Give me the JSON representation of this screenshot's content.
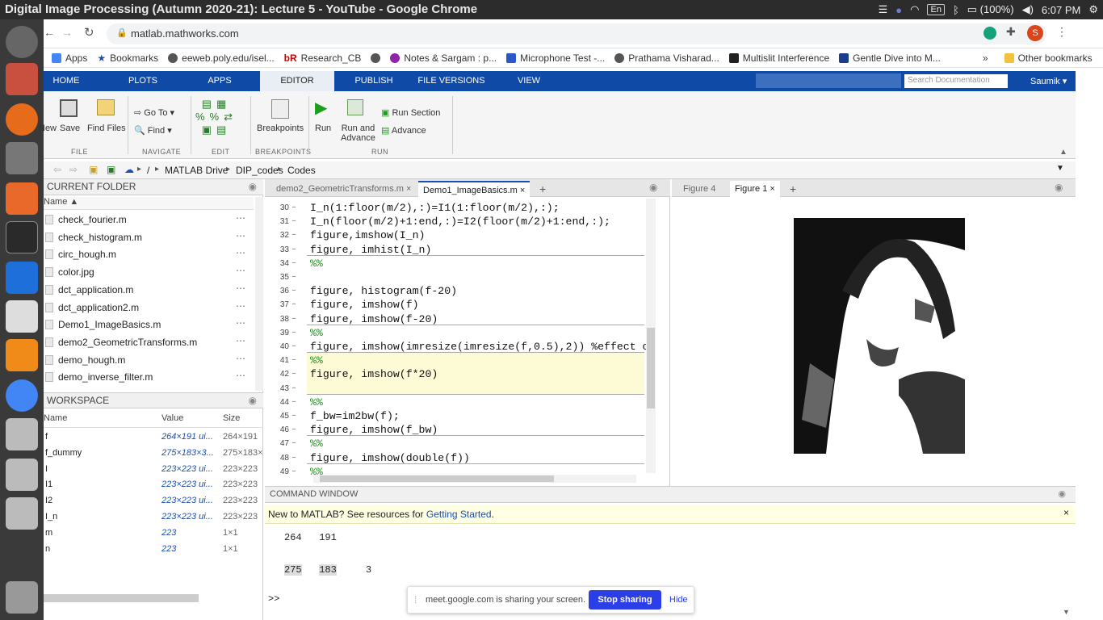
{
  "os": {
    "window_title": "Digital Image Processing (Autumn 2020-21): Lecture 5 - YouTube - Google Chrome",
    "lang": "En",
    "battery": "(100%)",
    "time": "6:07 PM"
  },
  "browser": {
    "url": "matlab.mathworks.com",
    "profile_initial": "S",
    "bookmarks": [
      "Apps",
      "Bookmarks",
      "eeweb.poly.edu/isel...",
      "Research_CB",
      "",
      "Notes & Sargam : p...",
      "Microphone Test -...",
      "Prathama Visharad...",
      "Multislit Interference",
      "Gentle Dive into M..."
    ],
    "bookmarks_more": "»",
    "other_bookmarks": "Other bookmarks"
  },
  "matlab": {
    "tabs": [
      "HOME",
      "PLOTS",
      "APPS",
      "EDITOR",
      "PUBLISH",
      "FILE VERSIONS",
      "VIEW"
    ],
    "search_placeholder": "Search Documentation",
    "user": "Saumik",
    "ribbon": {
      "new": "New",
      "save": "Save",
      "find_files": "Find Files",
      "go_to": "Go To",
      "find": "Find",
      "breakpoints": "Breakpoints",
      "run": "Run",
      "run_and_advance_1": "Run and",
      "run_and_advance_2": "Advance",
      "run_section": "Run Section",
      "advance": "Advance",
      "sections": [
        "FILE",
        "NAVIGATE",
        "EDIT",
        "BREAKPOINTS",
        "RUN"
      ]
    },
    "path": [
      "/",
      "MATLAB Drive",
      "DIP_codes",
      "Codes"
    ],
    "current_folder": {
      "title": "CURRENT FOLDER",
      "col_name": "Name",
      "files": [
        "check_fourier.m",
        "check_histogram.m",
        "circ_hough.m",
        "color.jpg",
        "dct_application.m",
        "dct_application2.m",
        "Demo1_ImageBasics.m",
        "demo2_GeometricTransforms.m",
        "demo_hough.m",
        "demo_inverse_filter.m"
      ]
    },
    "workspace": {
      "title": "WORKSPACE",
      "cols": [
        "Name",
        "Value",
        "Size"
      ],
      "rows": [
        {
          "name": "f",
          "value": "264×191 ui...",
          "size": "264×191"
        },
        {
          "name": "f_dummy",
          "value": "275×183×3...",
          "size": "275×183×"
        },
        {
          "name": "I",
          "value": "223×223 ui...",
          "size": "223×223"
        },
        {
          "name": "I1",
          "value": "223×223 ui...",
          "size": "223×223"
        },
        {
          "name": "I2",
          "value": "223×223 ui...",
          "size": "223×223"
        },
        {
          "name": "I_n",
          "value": "223×223 ui...",
          "size": "223×223"
        },
        {
          "name": "m",
          "value": "223",
          "size": "1×1"
        },
        {
          "name": "n",
          "value": "223",
          "size": "1×1"
        }
      ]
    },
    "editor": {
      "tabs": [
        "demo2_GeometricTransforms.m",
        "Demo1_ImageBasics.m"
      ],
      "lines": [
        {
          "n": "30",
          "code": "I_n(1:floor(m/2),:)=I1(1:floor(m/2),:);"
        },
        {
          "n": "31",
          "code": "I_n(floor(m/2)+1:end,:)=I2(floor(m/2)+1:end,:);"
        },
        {
          "n": "32",
          "code": "figure,imshow(I_n)"
        },
        {
          "n": "33",
          "code": "figure, imhist(I_n)"
        },
        {
          "n": "34",
          "code": "%%"
        },
        {
          "n": "35",
          "code": ""
        },
        {
          "n": "36",
          "code": "figure, histogram(f-20)"
        },
        {
          "n": "37",
          "code": "figure, imshow(f)"
        },
        {
          "n": "38",
          "code": "figure, imshow(f-20)"
        },
        {
          "n": "39",
          "code": "%%"
        },
        {
          "n": "40",
          "code": "figure, imshow(imresize(imresize(f,0.5),2)) %effect o"
        },
        {
          "n": "41",
          "code": "%%"
        },
        {
          "n": "42",
          "code": "figure, imshow(f*20)"
        },
        {
          "n": "43",
          "code": ""
        },
        {
          "n": "44",
          "code": "%%"
        },
        {
          "n": "45",
          "code": "f_bw=im2bw(f);"
        },
        {
          "n": "46",
          "code": "figure, imshow(f_bw)"
        },
        {
          "n": "47",
          "code": "%%"
        },
        {
          "n": "48",
          "code": "figure, imshow(double(f))"
        },
        {
          "n": "49",
          "code": "%%"
        }
      ]
    },
    "figures": {
      "tabs": [
        "Figure 4",
        "Figure 1"
      ]
    },
    "command_window": {
      "title": "COMMAND WINDOW",
      "banner_text": "New to MATLAB? See resources for ",
      "banner_link": "Getting Started",
      "banner_end": ".",
      "out1": [
        "264",
        "191"
      ],
      "out2": [
        "275",
        "183",
        "3"
      ],
      "prompt": ">>"
    }
  },
  "share_bar": {
    "text": "meet.google.com is sharing your screen.",
    "stop": "Stop sharing",
    "hide": "Hide"
  }
}
